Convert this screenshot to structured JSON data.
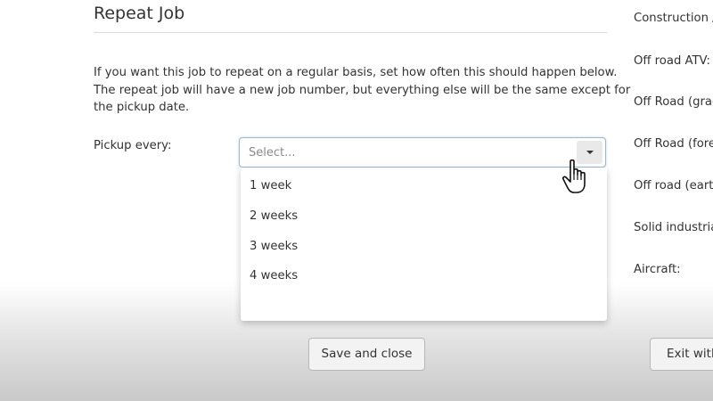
{
  "modal": {
    "title": "Repeat Job",
    "description_lines": [
      "If you want this job to repeat on a regular basis, set how often this should happen below.",
      "The repeat job will have a new job number, but everything else will be the same except for",
      "the pickup date."
    ],
    "pickup_label": "Pickup every:",
    "select": {
      "placeholder": "Select...",
      "expanded": true,
      "options": [
        "1 week",
        "2 weeks",
        "3 weeks",
        "4 weeks"
      ]
    },
    "save_button": "Save and close"
  },
  "background_form": {
    "labels": [
      "Construction /",
      "Off road ATV:",
      "Off Road (grac",
      "Off Road (fore",
      "Off road (eartl",
      "Solid industria",
      "Aircraft:"
    ],
    "exit_button": "Exit with"
  },
  "colors": {
    "select_border": "#9cb9cf",
    "toggle_bg": "#e9e9e9",
    "button_bg": "#f3f3f3"
  },
  "icons": {
    "select_toggle": "caret-down-icon",
    "cursor": "hand-pointer-icon"
  }
}
